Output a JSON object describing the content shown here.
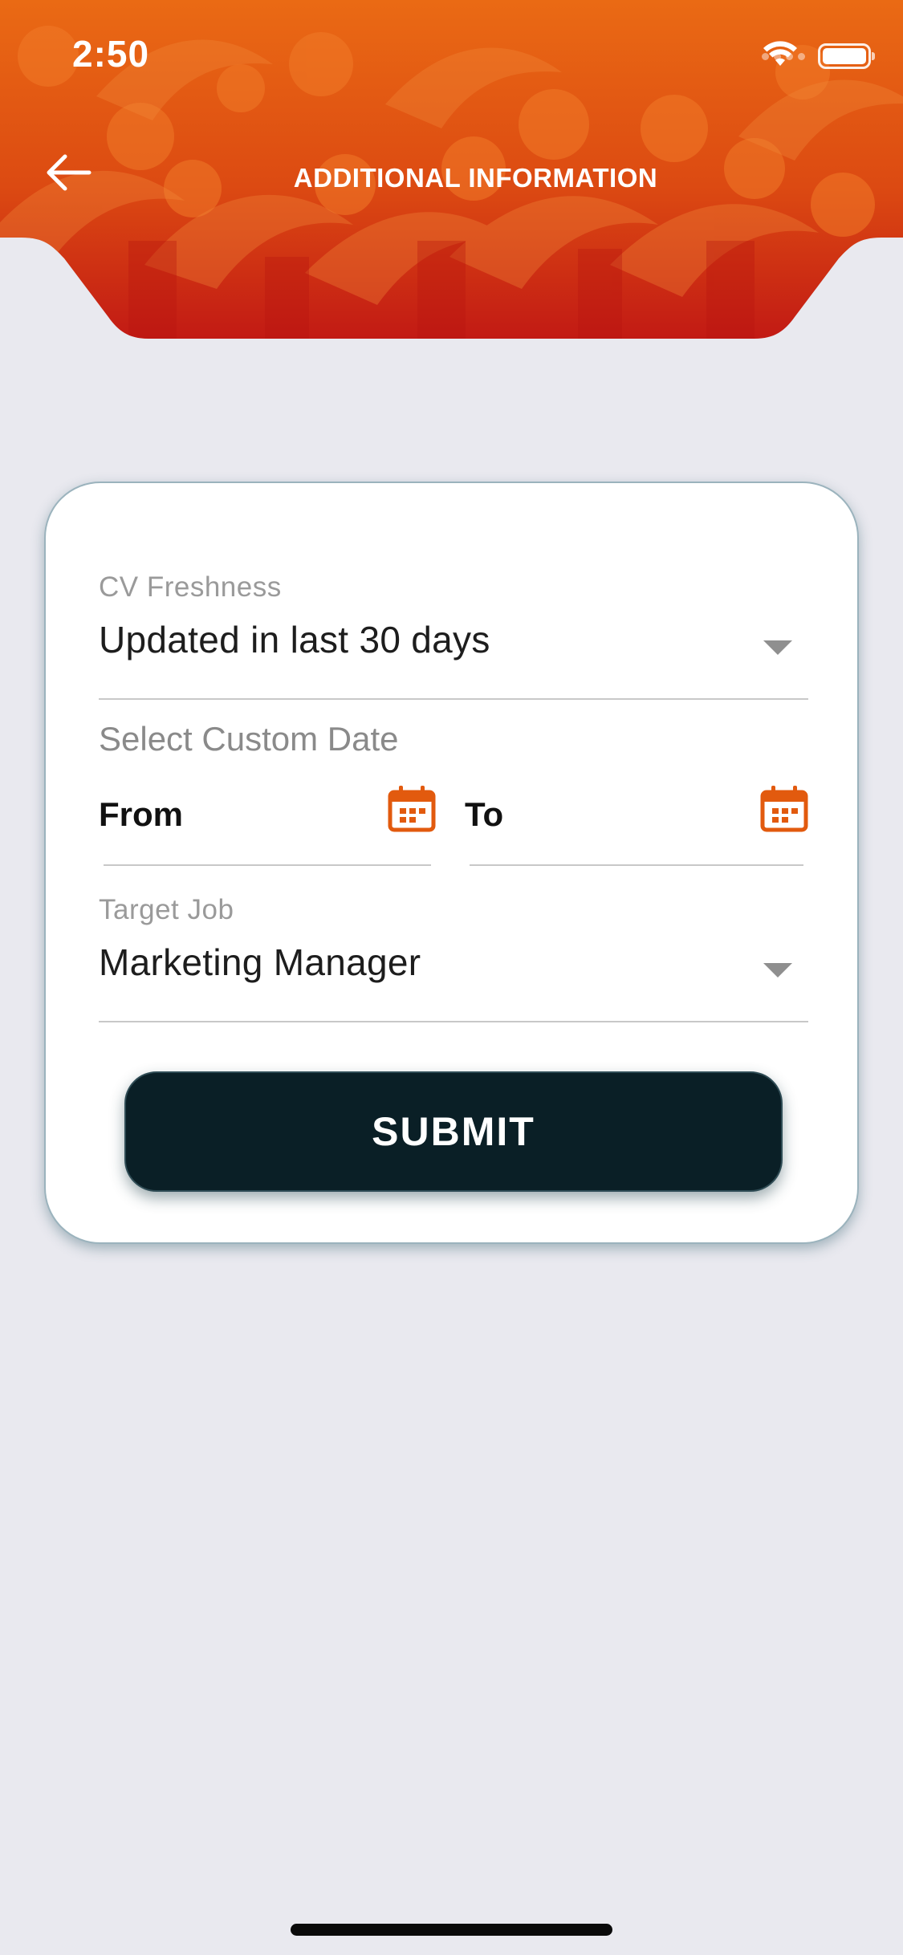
{
  "status_bar": {
    "time": "2:50",
    "icons": [
      "cellular-signal-icon",
      "wifi-icon",
      "battery-icon"
    ]
  },
  "header": {
    "back_icon": "arrow-left-icon",
    "title": "ADDITIONAL INFORMATION"
  },
  "form": {
    "cv_freshness": {
      "label": "CV Freshness",
      "value": "Updated in last 30 days"
    },
    "custom_date": {
      "label": "Select Custom Date",
      "from_label": "From",
      "to_label": "To"
    },
    "target_job": {
      "label": "Target Job",
      "value": "Marketing Manager"
    },
    "submit_label": "SUBMIT"
  },
  "colors": {
    "accent": "#e25a0e",
    "header_dark": "#c41f14",
    "button_bg": "#0a1f26",
    "page_bg": "#e9e9ef"
  }
}
